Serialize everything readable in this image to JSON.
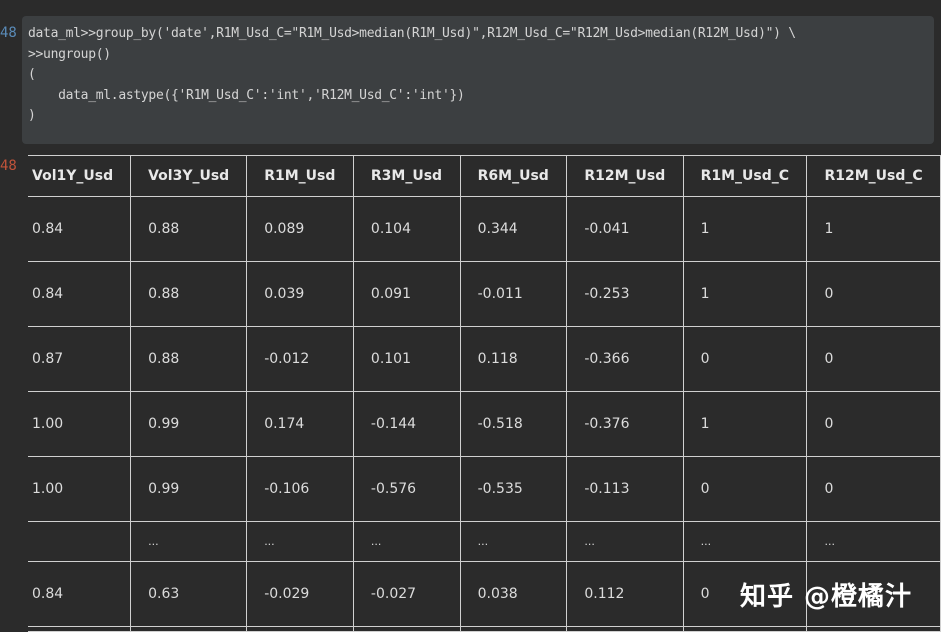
{
  "cell": {
    "input_prompt": "48",
    "output_prompt": "48",
    "code_lines": [
      "data_ml>>group_by('date',R1M_Usd_C=\"R1M_Usd>median(R1M_Usd)\",R12M_Usd_C=\"R12M_Usd>median(R12M_Usd)\") \\",
      ">>ungroup()",
      "(",
      "    data_ml.astype({'R1M_Usd_C':'int','R12M_Usd_C':'int'})",
      ")"
    ]
  },
  "table": {
    "columns": [
      "Vol1Y_Usd",
      "Vol3Y_Usd",
      "R1M_Usd",
      "R3M_Usd",
      "R6M_Usd",
      "R12M_Usd",
      "R1M_Usd_C",
      "R12M_Usd_C"
    ],
    "rows": [
      [
        "0.84",
        "0.88",
        "0.089",
        "0.104",
        "0.344",
        "-0.041",
        "1",
        "1"
      ],
      [
        "0.84",
        "0.88",
        "0.039",
        "0.091",
        "-0.011",
        "-0.253",
        "1",
        "0"
      ],
      [
        "0.87",
        "0.88",
        "-0.012",
        "0.101",
        "0.118",
        "-0.366",
        "0",
        "0"
      ],
      [
        "1.00",
        "0.99",
        "0.174",
        "-0.144",
        "-0.518",
        "-0.376",
        "1",
        "0"
      ],
      [
        "1.00",
        "0.99",
        "-0.106",
        "-0.576",
        "-0.535",
        "-0.113",
        "0",
        "0"
      ],
      [
        "",
        "...",
        "...",
        "...",
        "...",
        "...",
        "...",
        "..."
      ],
      [
        "0.84",
        "0.63",
        "-0.029",
        "-0.027",
        "0.038",
        "0.112",
        "0",
        ""
      ],
      [
        "",
        "",
        "",
        "",
        "",
        "",
        "",
        ""
      ]
    ]
  },
  "watermark": "知乎 @橙橘汁"
}
